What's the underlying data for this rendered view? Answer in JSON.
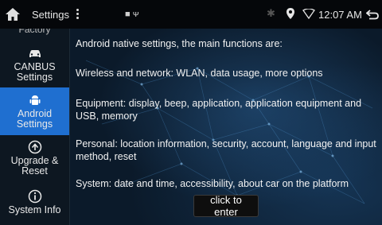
{
  "statusbar": {
    "title": "Settings",
    "notification_text": "■ ᴪ",
    "time": "12:07 AM"
  },
  "sidebar": {
    "partial_label": "Factory",
    "items": [
      {
        "label": "CANBUS\nSettings",
        "icon": "car-icon",
        "active": false
      },
      {
        "label": "Android\nSettings",
        "icon": "android-icon",
        "active": true
      },
      {
        "label": "Upgrade &\nReset",
        "icon": "upgrade-icon",
        "active": false
      },
      {
        "label": "System Info",
        "icon": "info-icon",
        "active": false
      }
    ]
  },
  "main": {
    "intro": "Android native settings, the main functions are:",
    "wireless": "Wireless and network: WLAN, data usage, more options",
    "equipment": "Equipment: display, beep, application, application equipment and USB, memory",
    "personal": "Personal: location information, security, account, language and input method, reset",
    "system": "System: date and time, accessibility, about car on the platform",
    "enter_button": "click to enter"
  },
  "colors": {
    "active": "#1f6fd0",
    "statusbar": "#05070a"
  }
}
